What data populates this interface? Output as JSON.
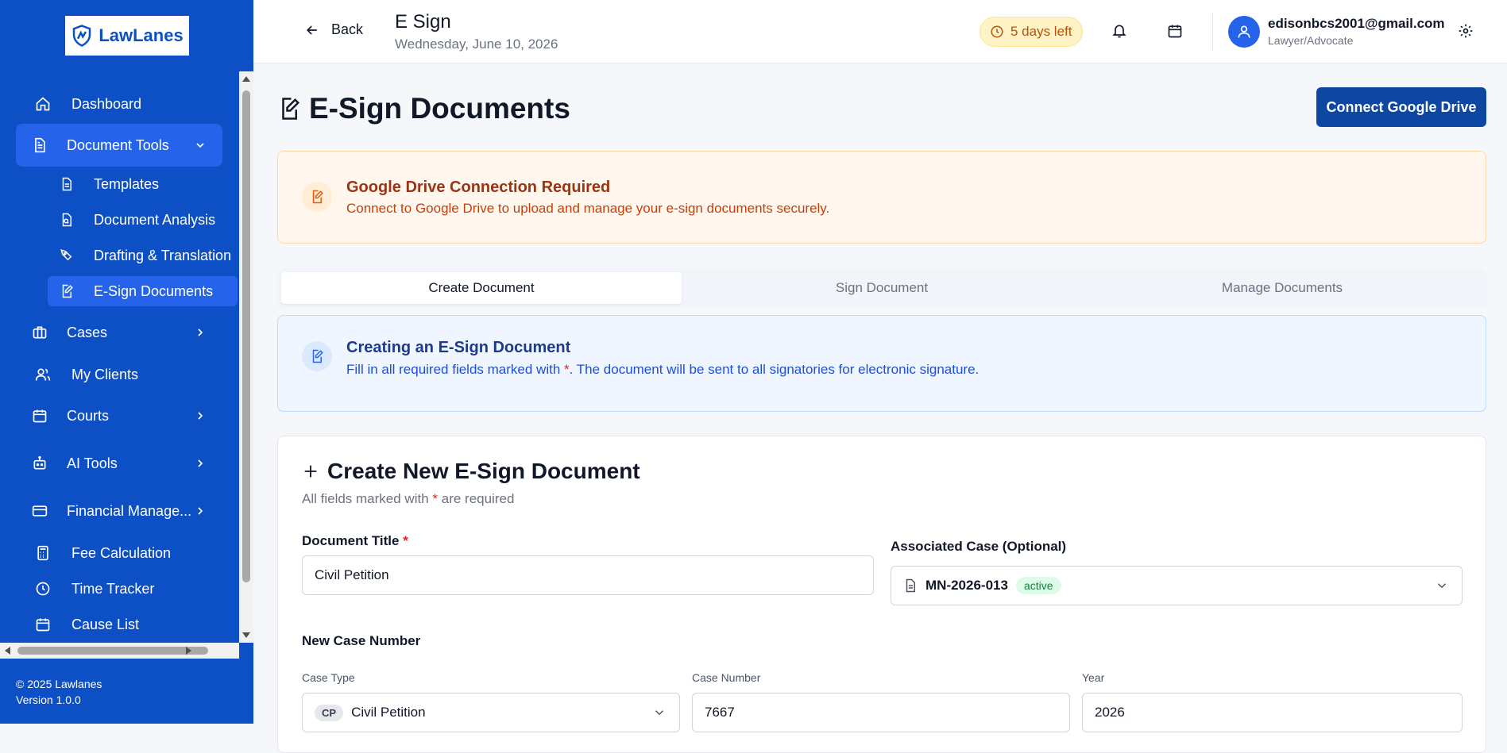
{
  "brand": {
    "name": "LawLanes"
  },
  "sidebar": {
    "items": [
      {
        "label": "Dashboard",
        "icon": "home-icon"
      },
      {
        "label": "Document Tools",
        "icon": "document-icon"
      },
      {
        "label": "Cases",
        "icon": "briefcase-icon"
      },
      {
        "label": "My Clients",
        "icon": "users-icon"
      },
      {
        "label": "Courts",
        "icon": "calendar-icon"
      },
      {
        "label": "AI Tools",
        "icon": "bot-icon"
      },
      {
        "label": "Financial Manage...",
        "icon": "credit-card-icon"
      },
      {
        "label": "Fee Calculation",
        "icon": "calculator-icon"
      },
      {
        "label": "Time Tracker",
        "icon": "clock-icon"
      },
      {
        "label": "Cause List",
        "icon": "calendar-icon"
      }
    ],
    "subitems": [
      {
        "label": "Templates",
        "icon": "file-text-icon"
      },
      {
        "label": "Document Analysis",
        "icon": "file-search-icon"
      },
      {
        "label": "Drafting & Translation",
        "icon": "pen-tool-icon"
      },
      {
        "label": "E-Sign Documents",
        "icon": "file-signature-icon"
      }
    ],
    "footer": {
      "copyright": "© 2025 Lawlanes",
      "version": "Version 1.0.0"
    }
  },
  "header": {
    "back_label": "Back",
    "title": "E Sign",
    "date": "Wednesday, June 10, 2026",
    "trial": "5 days left",
    "user_email": "edisonbcs2001@gmail.com",
    "user_role": "Lawyer/Advocate"
  },
  "page": {
    "title": "E-Sign Documents",
    "connect_button": "Connect Google Drive",
    "alert": {
      "title": "Google Drive Connection Required",
      "desc": "Connect to Google Drive to upload and manage your e-sign documents securely."
    },
    "tabs": [
      {
        "label": "Create Document"
      },
      {
        "label": "Sign Document"
      },
      {
        "label": "Manage Documents"
      }
    ],
    "info": {
      "title": "Creating an E-Sign Document",
      "desc_before": "Fill in all required fields marked with ",
      "asterisk": "*",
      "desc_after": ". The document will be sent to all signatories for electronic signature."
    },
    "form": {
      "title": "Create New E-Sign Document",
      "subtitle_before": "All fields marked with ",
      "subtitle_after": " are required",
      "doc_title_label": "Document Title",
      "doc_title_value": "Civil Petition",
      "assoc_case_label": "Associated Case (Optional)",
      "assoc_case_value": "MN-2026-013",
      "assoc_case_status": "active",
      "new_case_label": "New Case Number",
      "case_type_label": "Case Type",
      "case_type_code": "CP",
      "case_type_value": "Civil Petition",
      "case_number_label": "Case Number",
      "case_number_value": "7667",
      "year_label": "Year",
      "year_value": "2026"
    }
  },
  "colors": {
    "sidebar": "#0d4fc4",
    "accent": "#2563eb",
    "button": "#0d47a1"
  }
}
